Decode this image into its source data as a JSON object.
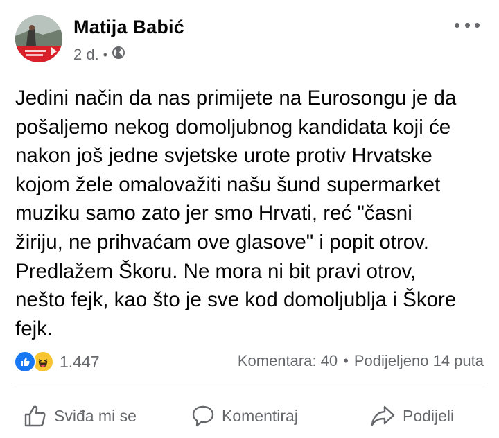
{
  "post": {
    "author": "Matija Babić",
    "time": "2 d.",
    "separator": "•",
    "privacy_icon": "globe-icon",
    "more_icon": "more-icon",
    "text": "Jedini način da nas primijete na Eurosongu je da\npošaljemo nekog domoljubnog kandidata koji će\nnakon još jedne svjetske urote protiv Hrvatske\nkojom žele omalovažiti našu šund supermarket\nmuziku samo zato jer smo Hrvati, reć \"časni\nžiriju, ne prihvaćam ove glasove\" i popit otrov.\nPredlažem Škoru. Ne mora ni bit pravi otrov,\nnešto fejk, kao što je sve kod domoljublja i Škore\nfejk."
  },
  "stats": {
    "reaction_icons": [
      "like-icon",
      "haha-icon"
    ],
    "reaction_count": "1.447",
    "comments": "Komentara: 40",
    "separator": "•",
    "shares": "Podijeljeno 14 puta"
  },
  "actions": {
    "like_label": "Sviđa mi se",
    "comment_label": "Komentiraj",
    "share_label": "Podijeli"
  },
  "colors": {
    "like_blue": "#1877f2",
    "haha_yellow": "#f7c531",
    "secondary_text": "#65676b",
    "divider": "#ced0d4"
  }
}
